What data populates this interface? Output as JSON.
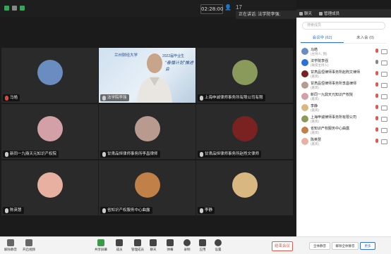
{
  "topbar": {
    "time": "02:28:00",
    "signal": "17",
    "speaking": "正在讲话: 法学院李强;"
  },
  "tiles": [
    {
      "name": "马皓",
      "color": "#6a8cc0"
    },
    {
      "name": "法学院李强",
      "color": "#c8a48a"
    },
    {
      "name": "上海申诚律师事务所有限公司有限",
      "color": "#8a9a5a"
    },
    {
      "name": "新同一九鼎天元知识产权院",
      "color": "#d4a0a8"
    },
    {
      "name": "甘肃品恒律师事务所李昌律师",
      "color": "#b89a8e"
    },
    {
      "name": "甘肃品恒律师事务所赵煦文律师",
      "color": "#7a2222"
    },
    {
      "name": "陈英慧",
      "color": "#e8b0a0"
    },
    {
      "name": "省知识产权服务中心曲露",
      "color": "#c08048"
    },
    {
      "name": "李静",
      "color": "#d8b880"
    }
  ],
  "banner": {
    "line1": "兰州财经大学",
    "line2": "2022届毕业生",
    "line3": "“春播计划”推进会"
  },
  "toolbar": {
    "items": [
      {
        "label": "解除静音",
        "color": "#666"
      },
      {
        "label": "开启视频",
        "color": "#666"
      },
      {
        "label": "共享屏幕",
        "color": "#3a9a4a"
      },
      {
        "label": "成员",
        "color": "#444"
      },
      {
        "label": "管理成员",
        "color": "#444"
      },
      {
        "label": "聊天",
        "color": "#444"
      },
      {
        "label": "弹幕",
        "color": "#444"
      },
      {
        "label": "录制",
        "color": "#444"
      },
      {
        "label": "应用",
        "color": "#444"
      },
      {
        "label": "设置",
        "color": "#444"
      }
    ],
    "end_label": "结束会议"
  },
  "panel": {
    "tabs": [
      "聊天",
      "管理成员"
    ],
    "search_placeholder": "搜索成员",
    "subtabs": [
      "会议中 (62)",
      "未入会 (0)"
    ],
    "participants": [
      {
        "name": "马皓",
        "role": "(主持人, 我)",
        "color": "#6a8cc0"
      },
      {
        "name": "法学院李强",
        "role": "(联席主持人)",
        "color": "#2e6fd6"
      },
      {
        "name": "甘肃品恒律师事务所赵煦文律师",
        "role": "(嘉宾)",
        "color": "#7a2222"
      },
      {
        "name": "甘肃品恒律师事务所李昌律师",
        "role": "(嘉宾)",
        "color": "#b89a8e"
      },
      {
        "name": "新同一九鼎天元知识产权院",
        "role": "(嘉宾)",
        "color": "#d4a0a8"
      },
      {
        "name": "李静",
        "role": "(嘉宾)",
        "color": "#d8b880"
      },
      {
        "name": "上海申诚律师事务所有限公司",
        "role": "(嘉宾)",
        "color": "#8a9a5a"
      },
      {
        "name": "省知识产权服务中心曲露",
        "role": "(嘉宾)",
        "color": "#c08048"
      },
      {
        "name": "陈英慧",
        "role": "(嘉宾)",
        "color": "#e8b0a0"
      }
    ],
    "buttons": {
      "mute_all": "全体静音",
      "unmute_all": "解除全体静音",
      "more": "更多"
    }
  }
}
